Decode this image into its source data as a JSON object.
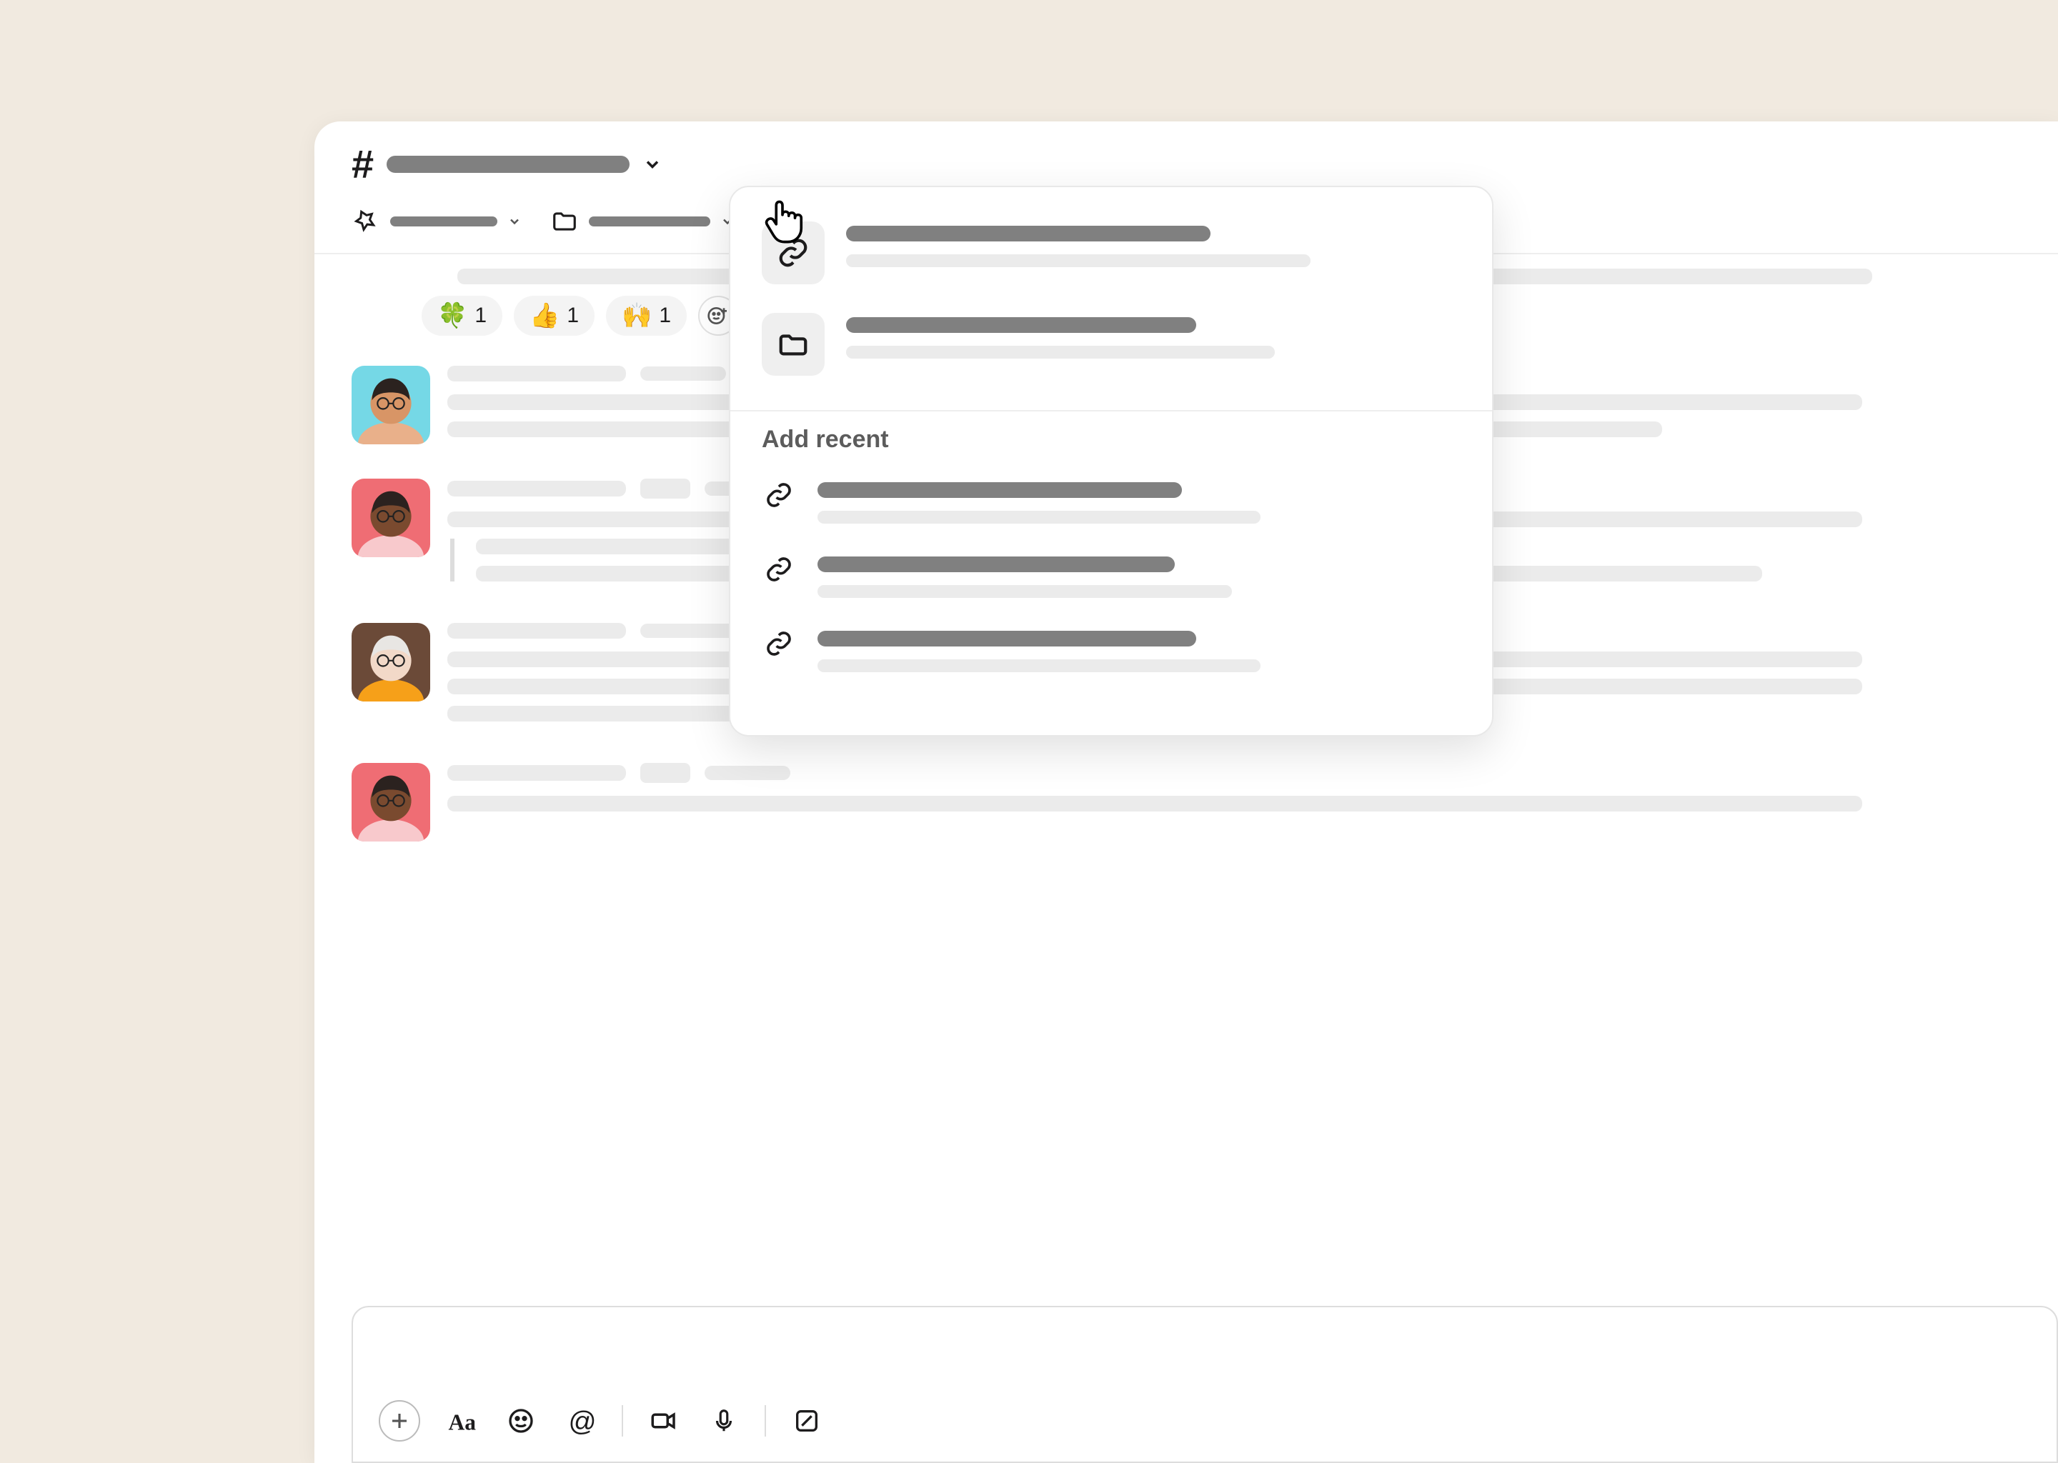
{
  "channel": {
    "name_placeholder": "",
    "bookmarks": [
      {
        "icon": "pin",
        "label": ""
      },
      {
        "icon": "folder",
        "label": ""
      },
      {
        "icon": "figma",
        "label": ""
      }
    ]
  },
  "reactions": [
    {
      "emoji": "🍀",
      "count": 1
    },
    {
      "emoji": "👍",
      "count": 1
    },
    {
      "emoji": "🙌",
      "count": 1
    }
  ],
  "popover": {
    "section_heading": "Add recent",
    "primary_items": [
      {
        "icon": "link"
      },
      {
        "icon": "folder"
      }
    ],
    "recent_items": [
      {
        "icon": "link"
      },
      {
        "icon": "link"
      },
      {
        "icon": "link"
      }
    ]
  },
  "composer": {
    "buttons": [
      "plus",
      "format",
      "emoji",
      "mention",
      "video",
      "audio",
      "canvas"
    ]
  },
  "avatars": [
    {
      "bg": "#75d8e6",
      "skin": "#d89566",
      "hair": "#2b221f",
      "shirt": "#e9b08a"
    },
    {
      "bg": "#ef6d74",
      "skin": "#7a4a2f",
      "hair": "#2b221f",
      "shirt": "#f8c9cc"
    },
    {
      "bg": "#6b4a38",
      "skin": "#f2d9c8",
      "hair": "#e8e6e3",
      "shirt": "#f6a019"
    },
    {
      "bg": "#ef6d74",
      "skin": "#7a4a2f",
      "hair": "#2b221f",
      "shirt": "#f8c9cc"
    }
  ]
}
